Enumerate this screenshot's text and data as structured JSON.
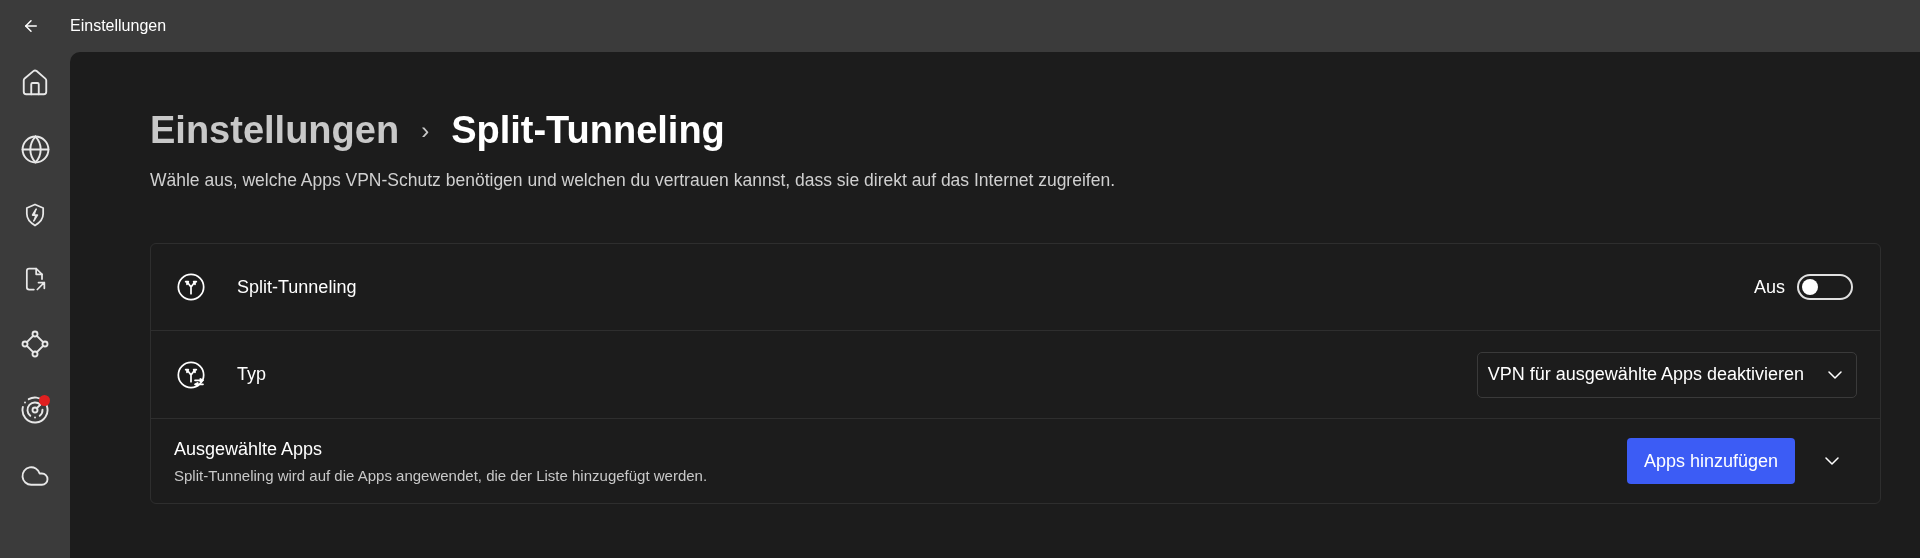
{
  "window": {
    "title": "Einstellungen"
  },
  "breadcrumb": {
    "parent": "Einstellungen",
    "separator": "›",
    "current": "Split-Tunneling"
  },
  "description": "Wähle aus, welche Apps VPN-Schutz benötigen und welchen du vertrauen kannst, dass sie direkt auf das Internet zugreifen.",
  "rows": [
    {
      "kind": "toggle",
      "label": "Split-Tunneling",
      "state_label": "Aus",
      "on": false
    },
    {
      "kind": "select",
      "label": "Typ",
      "value": "VPN für ausgewählte Apps deaktivieren"
    },
    {
      "kind": "expander",
      "label": "Ausgewählte Apps",
      "description": "Split-Tunneling wird auf die Apps angewendet, die der Liste hinzugefügt werden.",
      "button": "Apps hinzufügen",
      "expanded": false
    }
  ]
}
